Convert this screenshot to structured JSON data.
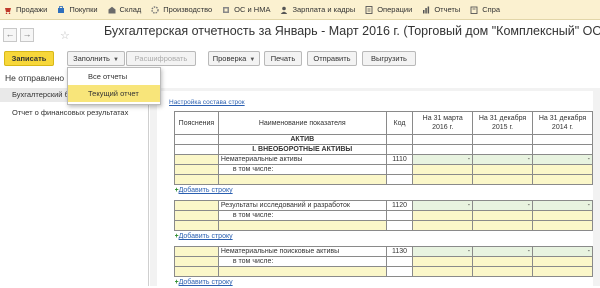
{
  "menu": [
    {
      "label": "Продажи",
      "icon": "sales-icon",
      "color": "#c0392b"
    },
    {
      "label": "Покупки",
      "icon": "purchases-icon",
      "color": "#2e6fbd"
    },
    {
      "label": "Склад",
      "icon": "warehouse-icon",
      "color": "#6b6b6b"
    },
    {
      "label": "Производство",
      "icon": "production-icon",
      "color": "#777"
    },
    {
      "label": "ОС и НМА",
      "icon": "assets-icon",
      "color": "#777"
    },
    {
      "label": "Зарплата и кадры",
      "icon": "salary-icon",
      "color": "#555"
    },
    {
      "label": "Операции",
      "icon": "operations-icon",
      "color": "#555"
    },
    {
      "label": "Отчеты",
      "icon": "reports-icon",
      "color": "#555"
    },
    {
      "label": "Спра",
      "icon": "reference-icon",
      "color": "#555"
    }
  ],
  "title": "Бухгалтерская отчетность за Январь - Март 2016 г. (Торговый дом \"Комплексный\" ООО) *",
  "toolbar": {
    "save": "Записать",
    "fill": "Заполнить",
    "decode": "Расшифровать",
    "check": "Проверка",
    "print": "Печать",
    "send": "Отправить",
    "export": "Выгрузить"
  },
  "status": "Не отправлено",
  "dropdown": [
    "Все отчеты",
    "Текущий отчет"
  ],
  "sidebar": [
    "Бухгалтерский баланс",
    "Отчет о финансовых результатах"
  ],
  "report": {
    "setting_link": "Настройка состава строк",
    "headers": [
      "Пояснения",
      "Наименование показателя",
      "Код",
      "На 31 марта 2016 г.",
      "На 31 декабря 2015 г.",
      "На 31 декабря 2014 г."
    ],
    "section": "АКТИВ",
    "subsection": "I. ВНЕОБОРОТНЫЕ АКТИВЫ",
    "rows": [
      {
        "name": "Нематериальные активы",
        "code": "1110",
        "v1": "-",
        "v2": "-",
        "v3": "-"
      },
      {
        "name": "Результаты исследований и разработок",
        "code": "1120",
        "v1": "-",
        "v2": "-",
        "v3": "-"
      },
      {
        "name": "Нематериальные поисковые активы",
        "code": "1130",
        "v1": "-",
        "v2": "-",
        "v3": "-"
      }
    ],
    "including": "в том числе:",
    "add_row": "Добавить строку",
    "dash": "-"
  }
}
